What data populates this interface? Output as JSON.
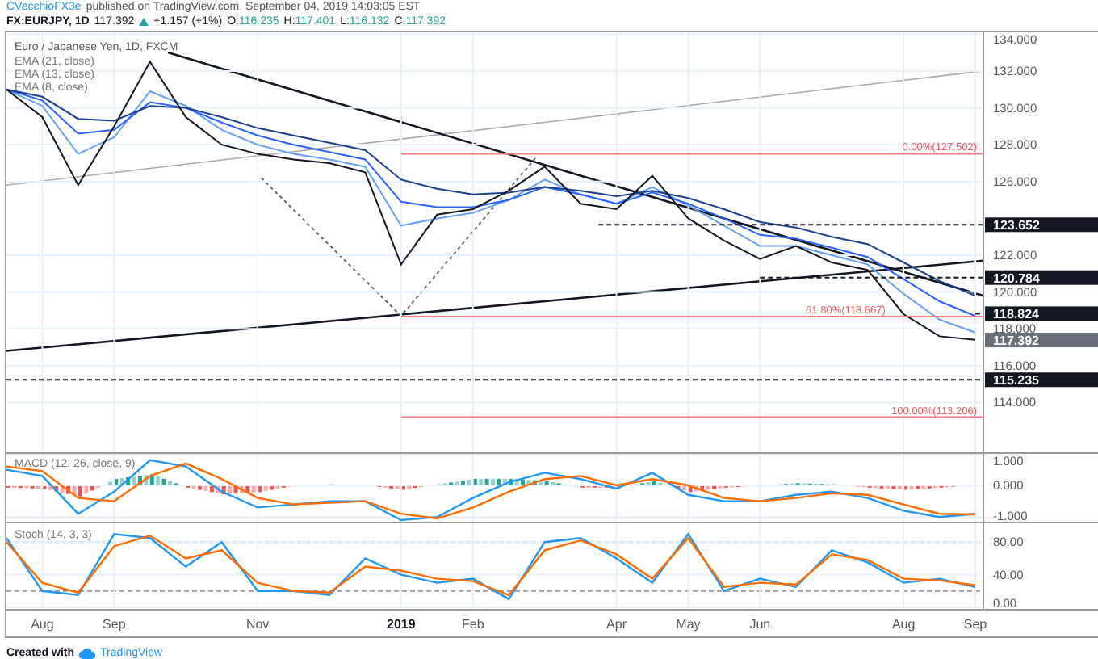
{
  "header": {
    "author": "CVecchioFX3e",
    "published": "published on TradingView.com, September 04, 2019 14:03:05 EST"
  },
  "quote": {
    "symbol": "FX:EURJPY, 1D",
    "last": "117.392",
    "rising": true,
    "change": "+1.157 (+1%)",
    "ohlc": [
      {
        "label": "O:",
        "value": "116.235"
      },
      {
        "label": "H:",
        "value": "117.401"
      },
      {
        "label": "L:",
        "value": "116.132"
      },
      {
        "label": "C:",
        "value": "117.392"
      }
    ]
  },
  "price_pane": {
    "indicators": [
      "EMA (21, close)",
      "EMA (13, close)",
      "EMA (8, close)"
    ],
    "levels": [
      {
        "kind": "fib",
        "label": "0.00%(127.502)"
      },
      {
        "kind": "fib",
        "label": "61.80%(118.667)"
      },
      {
        "kind": "fib",
        "label": "100.00%(113.206)"
      },
      {
        "kind": "tag",
        "label": "123.652"
      },
      {
        "kind": "tag",
        "label": "120.784"
      },
      {
        "kind": "tag",
        "label": "118.824"
      },
      {
        "kind": "last",
        "label": "117.392"
      },
      {
        "kind": "tag",
        "label": "115.235"
      }
    ],
    "chart_data": {
      "type": "line",
      "title": "Euro / Japanese Yen, 1D, FXCM",
      "grid": true,
      "categories": [
        null,
        null,
        null,
        null,
        null,
        null,
        null,
        null,
        null,
        null,
        null,
        null,
        null,
        null,
        null,
        null,
        null,
        null,
        null,
        null,
        null,
        null,
        null,
        null,
        null,
        null,
        null,
        null
      ],
      "series": [
        {
          "color": "#131722",
          "values": [
            131,
            129.5,
            125.8,
            129,
            132.5,
            129.5,
            128,
            127.5,
            127.2,
            127,
            126.5,
            121.5,
            124.2,
            124.5,
            125.5,
            126.8,
            124.8,
            124.5,
            126.3,
            124,
            122.8,
            121.8,
            122.5,
            121.6,
            121.2,
            118.8,
            117.6,
            117.4
          ]
        },
        {
          "color": "#1a3f8f",
          "values": [
            131,
            130.6,
            129.4,
            129.3,
            130.1,
            130.0,
            129.5,
            128.9,
            128.5,
            128.1,
            127.7,
            126.1,
            125.6,
            125.3,
            125.4,
            125.7,
            125.5,
            125.2,
            125.5,
            125.1,
            124.5,
            123.8,
            123.5,
            123.0,
            122.6,
            121.6,
            120.6,
            119.8
          ]
        },
        {
          "color": "#2962ff",
          "values": [
            131,
            130.4,
            128.6,
            128.8,
            130.3,
            130.0,
            129.2,
            128.5,
            128.0,
            127.6,
            127.2,
            124.9,
            124.6,
            124.6,
            125.0,
            125.7,
            125.3,
            124.8,
            125.4,
            124.8,
            124.0,
            123.1,
            122.9,
            122.4,
            121.9,
            120.7,
            119.5,
            118.7
          ]
        },
        {
          "color": "#64a0f5",
          "values": [
            131,
            130.1,
            127.5,
            128.4,
            130.9,
            130.1,
            128.8,
            128.0,
            127.5,
            127.2,
            126.8,
            123.6,
            124.0,
            124.3,
            125.0,
            126.1,
            125.3,
            124.8,
            125.7,
            124.7,
            123.6,
            122.5,
            122.5,
            122.0,
            121.5,
            119.9,
            118.5,
            117.8
          ]
        }
      ],
      "ylim": [
        111.3,
        134.1
      ],
      "yticks": [
        {
          "value": 134,
          "label": "134.000"
        },
        {
          "value": 132,
          "label": "132.000"
        },
        {
          "value": 130,
          "label": "130.000"
        },
        {
          "value": 128,
          "label": "128.000"
        },
        {
          "value": 126,
          "label": "126.000"
        },
        {
          "value": 122,
          "label": "122.000"
        },
        {
          "value": 120,
          "label": "120.000"
        },
        {
          "value": 118,
          "label": "118.000"
        },
        {
          "value": 116,
          "label": "116.000"
        },
        {
          "value": 114,
          "label": "114.000"
        }
      ]
    }
  },
  "macd_pane": {
    "legend": "MACD (12, 26, close, 9)",
    "chart_data": {
      "type": "line",
      "grid": true,
      "categories": [
        null,
        null,
        null,
        null,
        null,
        null,
        null,
        null,
        null,
        null,
        null,
        null,
        null,
        null,
        null,
        null,
        null,
        null,
        null,
        null,
        null,
        null,
        null,
        null,
        null,
        null,
        null,
        null
      ],
      "series": [
        {
          "color": "#2196f3",
          "values": [
            0.5,
            0.3,
            -0.9,
            -0.2,
            0.8,
            0.6,
            -0.2,
            -0.7,
            -0.6,
            -0.5,
            -0.5,
            -1.1,
            -1.0,
            -0.4,
            0.1,
            0.4,
            0.2,
            -0.1,
            0.4,
            -0.3,
            -0.5,
            -0.5,
            -0.3,
            -0.2,
            -0.4,
            -0.8,
            -1.0,
            -0.9
          ]
        },
        {
          "color": "#ff6d00",
          "values": [
            0.6,
            0.45,
            -0.4,
            -0.5,
            0.3,
            0.7,
            0.2,
            -0.4,
            -0.6,
            -0.55,
            -0.5,
            -0.9,
            -1.05,
            -0.7,
            -0.2,
            0.2,
            0.3,
            0.0,
            0.2,
            0.0,
            -0.4,
            -0.5,
            -0.4,
            -0.25,
            -0.3,
            -0.6,
            -0.9,
            -0.92
          ]
        }
      ],
      "ylim": [
        -1.15,
        1.0
      ],
      "yticks": [
        {
          "value": 1,
          "label": "1.000"
        },
        {
          "value": 0,
          "label": "0.000"
        },
        {
          "value": -1,
          "label": "-1.000"
        }
      ]
    }
  },
  "stoch_pane": {
    "legend": "Stoch (14, 3, 3)",
    "chart_data": {
      "type": "line",
      "grid": true,
      "categories": [
        null,
        "Aug",
        null,
        "Sep",
        null,
        null,
        null,
        "Nov",
        null,
        null,
        null,
        "2019",
        null,
        "Feb",
        null,
        null,
        null,
        "Apr",
        null,
        "May",
        null,
        "Jun",
        null,
        null,
        null,
        "Aug",
        null,
        "Sep"
      ],
      "series": [
        {
          "color": "#2196f3",
          "values": [
            85,
            20,
            15,
            90,
            85,
            50,
            80,
            20,
            20,
            15,
            60,
            40,
            30,
            35,
            10,
            80,
            85,
            60,
            30,
            90,
            20,
            35,
            25,
            70,
            55,
            30,
            35,
            25
          ]
        },
        {
          "color": "#ff6d00",
          "values": [
            80,
            30,
            18,
            75,
            88,
            60,
            70,
            30,
            20,
            18,
            50,
            45,
            35,
            32,
            15,
            70,
            82,
            65,
            35,
            85,
            25,
            30,
            28,
            65,
            58,
            35,
            33,
            27
          ]
        }
      ],
      "ylim": [
        -2,
        103
      ],
      "yticks": [
        {
          "value": 80,
          "label": "80.00"
        },
        {
          "value": 40,
          "label": "40.00"
        },
        {
          "value": 0,
          "label": "0.00"
        }
      ]
    }
  },
  "footer": {
    "created_with": "Created with",
    "brand": "TradingView"
  }
}
